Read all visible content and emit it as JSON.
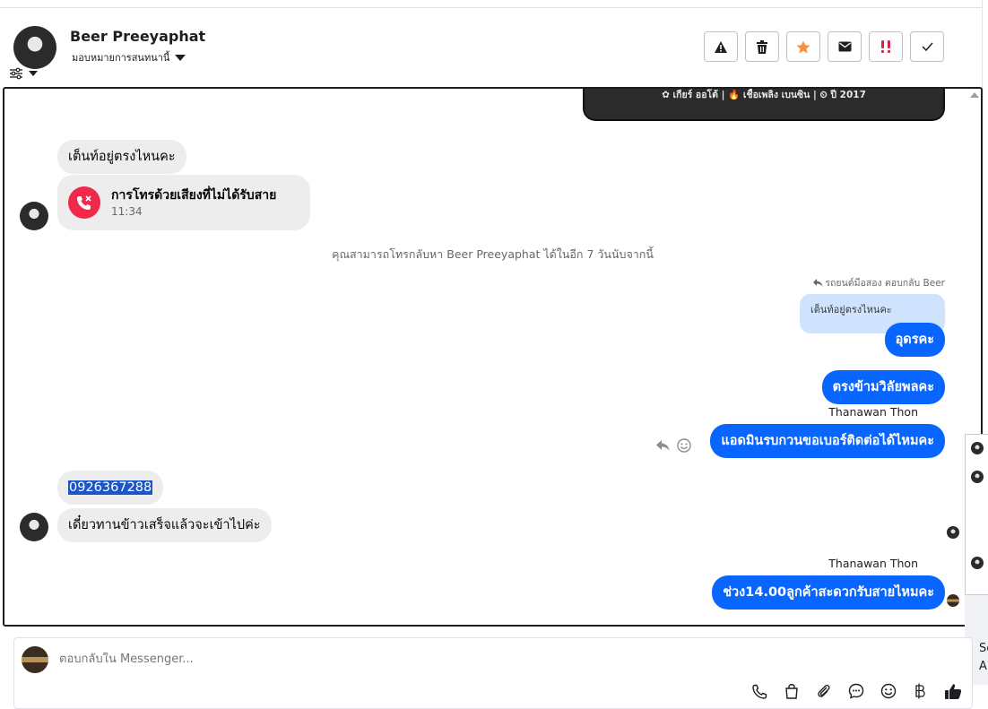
{
  "header": {
    "contact_name": "Beer Preeyaphat",
    "assign_label": "มอบหมายการสนทนานี้",
    "actions": [
      {
        "name": "report-spam",
        "icon": "warning-icon"
      },
      {
        "name": "delete",
        "icon": "trash-icon"
      },
      {
        "name": "star",
        "icon": "star-icon",
        "color": "#f7923b"
      },
      {
        "name": "mark-unread",
        "icon": "mail-icon"
      },
      {
        "name": "follow-up",
        "icon": "double-exclamation-icon",
        "color": "#e41e3f"
      },
      {
        "name": "mark-done",
        "icon": "check-icon"
      }
    ]
  },
  "card": {
    "specs": "✿ เกียร์ ออโต้   |   🔥 เชื้อเพลิง เบนซิน   |   ⏲ ปี 2017"
  },
  "messages": {
    "m1": "เต็นท์อยู่ตรงไหนคะ",
    "missed_call_title": "การโทรด้วยเสียงที่ไม่ได้รับสาย",
    "missed_call_time": "11:34",
    "system_note": "คุณสามารถโทรกลับหา Beer Preeyaphat ได้ในอีก 7 วันนับจากนี้",
    "reply_meta": "รถยนต์มือสอง ตอบกลับ Beer",
    "quoted": "เต็นท์อยู่ตรงไหนคะ",
    "out1": "อุดรคะ",
    "out2": "ตรงข้ามวิลัยพลคะ",
    "sender1": "Thanawan Thon",
    "out3": "แอดมินรบกวนขอเบอร์ติดต่อได้ไหมคะ",
    "phone": "0926367288",
    "in3": "เดี๋ยวทานข้าวเสร็จแล้วจะเข้าไปค่ะ",
    "sender2": "Thanawan Thon",
    "out4": "ช่วง14.00ลูกค้าสะดวกรับสายไหมคะ"
  },
  "composer": {
    "placeholder": "ตอบกลับใน Messenger..."
  },
  "side_panel": {
    "text1": "Sc",
    "text2": "A"
  }
}
